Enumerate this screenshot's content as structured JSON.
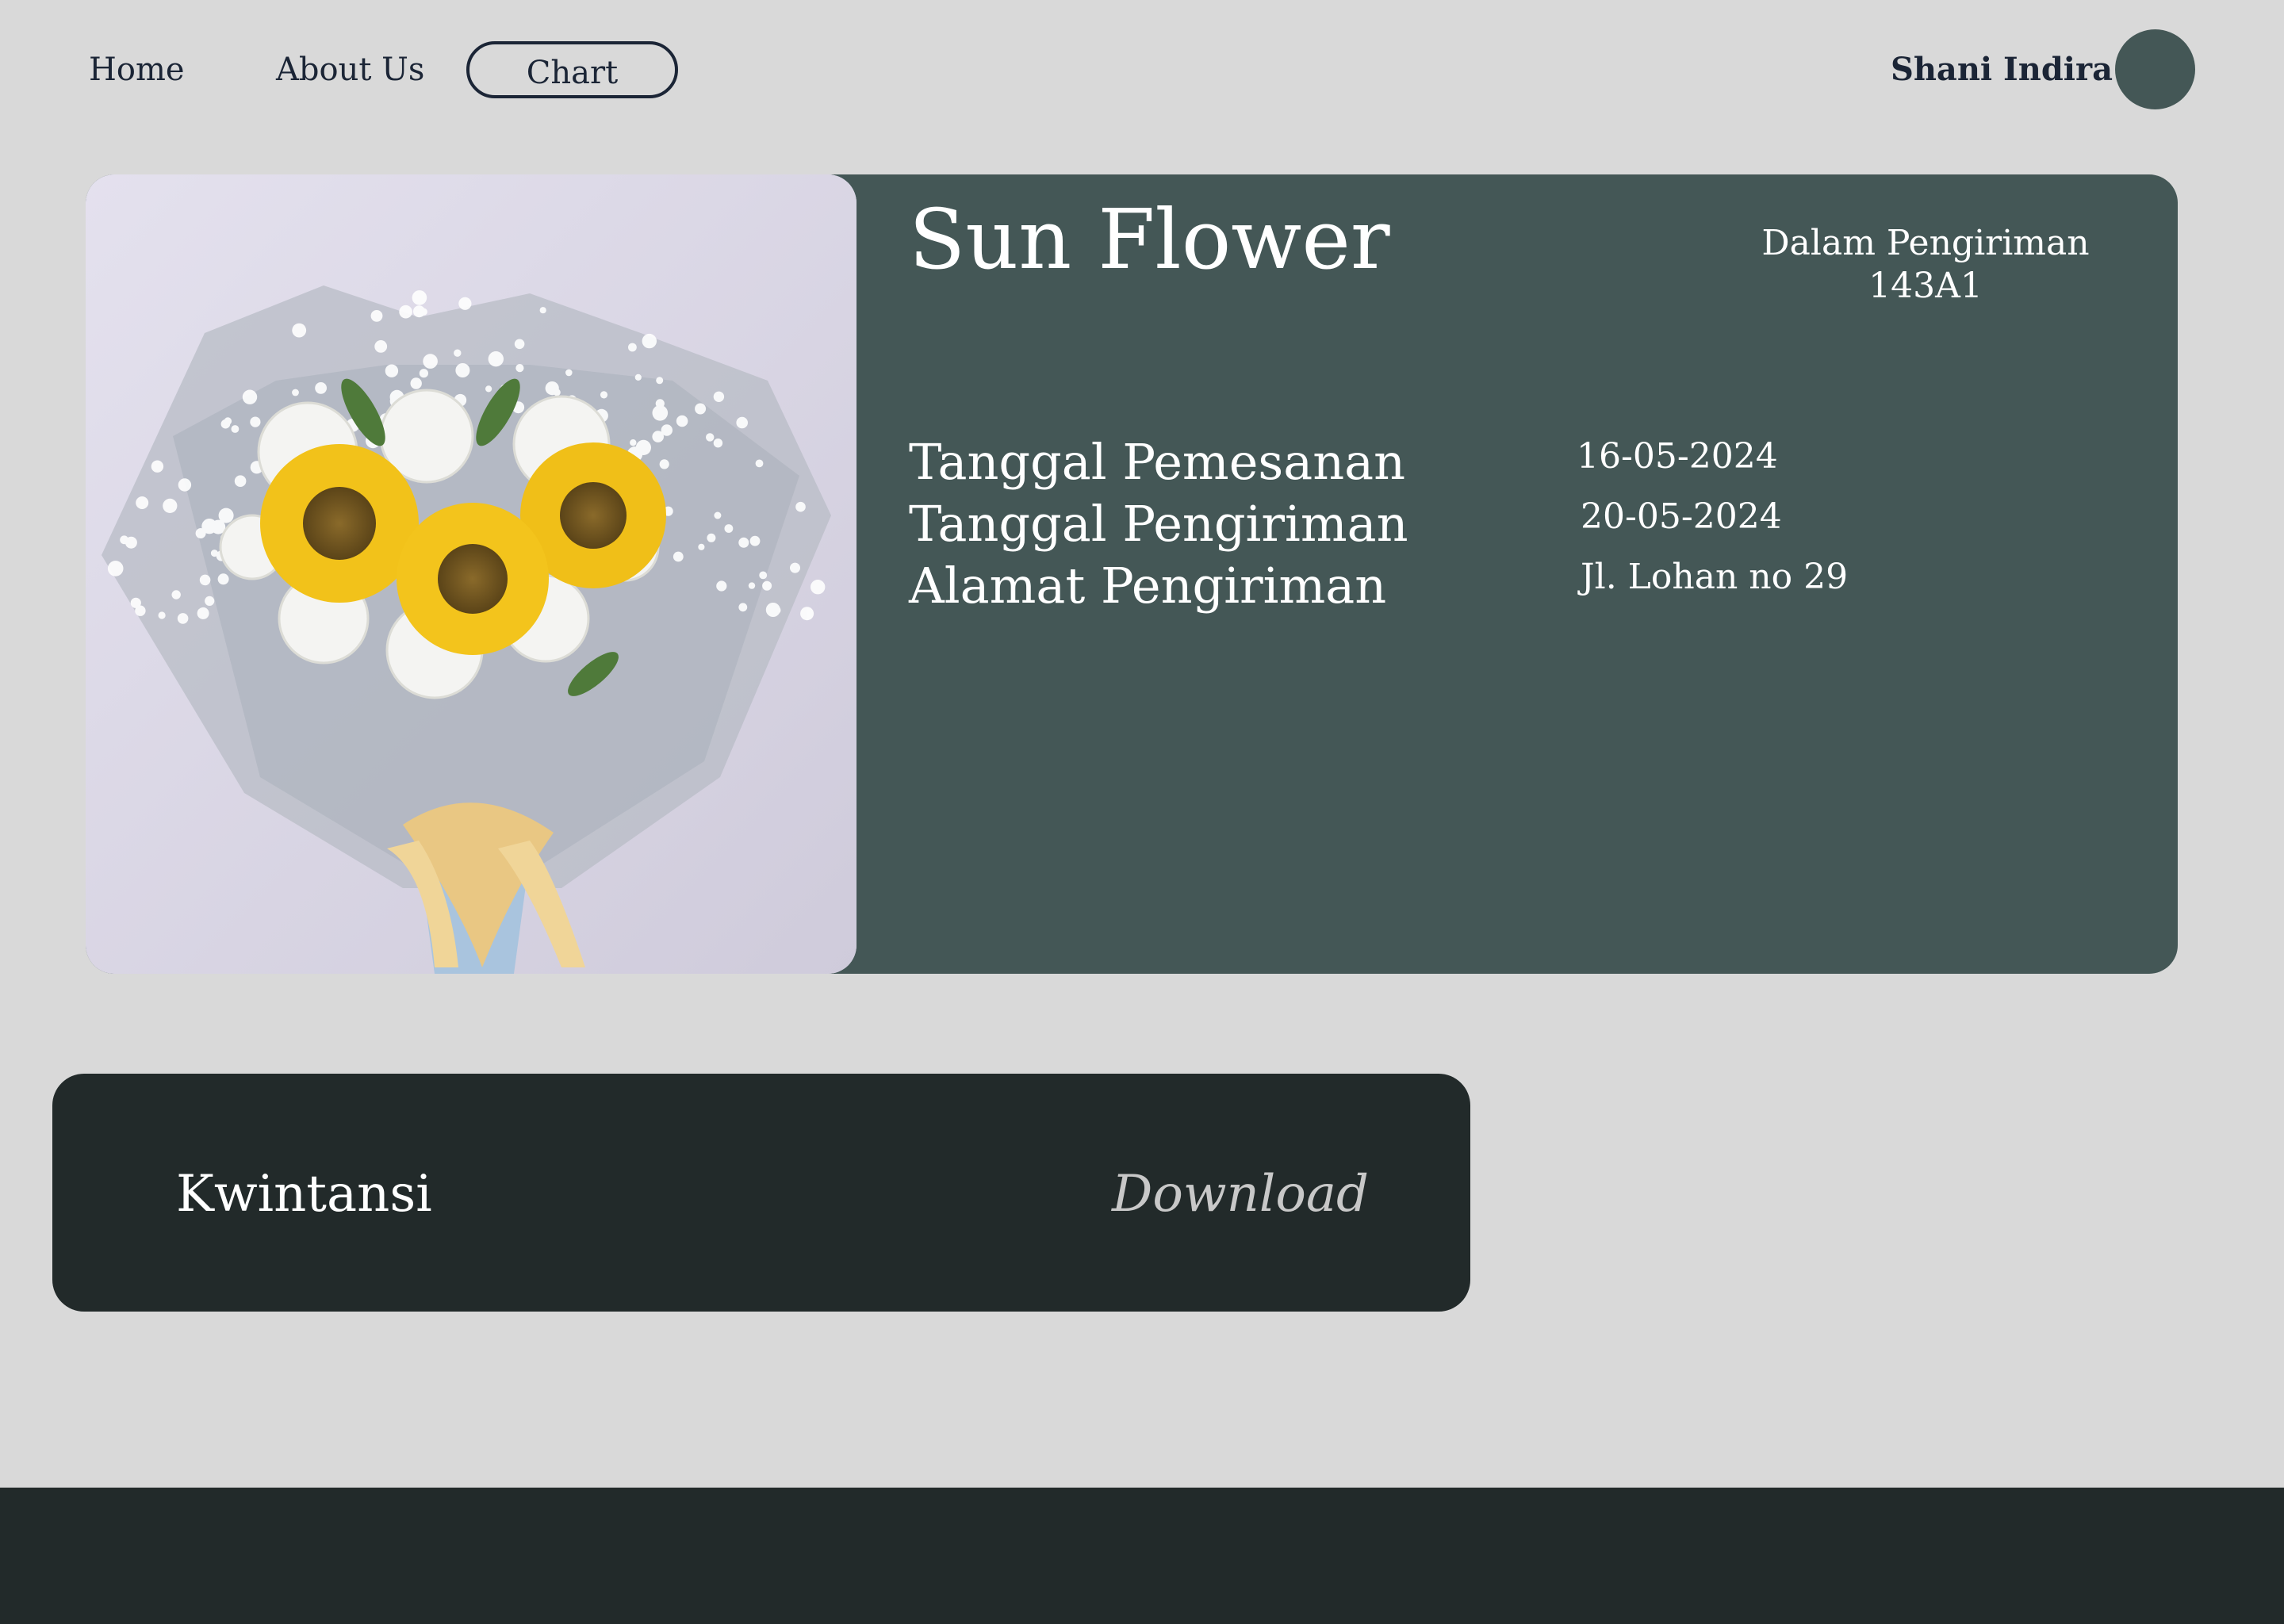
{
  "nav": {
    "home": "Home",
    "about": "About Us",
    "chart": "Chart"
  },
  "user": {
    "name": "Shani Indira"
  },
  "order": {
    "product_name": "Sun Flower",
    "status": "Dalam Pengiriman",
    "order_code": "143A1",
    "details": [
      {
        "label": "Tanggal Pemesanan",
        "value": "16-05-2024"
      },
      {
        "label": "Tanggal Pengiriman",
        "value": "20-05-2024"
      },
      {
        "label": "Alamat Pengiriman",
        "value": "Jl. Lohan no 29"
      }
    ]
  },
  "receipt": {
    "label": "Kwintansi",
    "download": "Download"
  },
  "colors": {
    "background": "#d9d9d9",
    "card": "#445756",
    "dark": "#222a2a",
    "text_dark": "#1b2536"
  }
}
